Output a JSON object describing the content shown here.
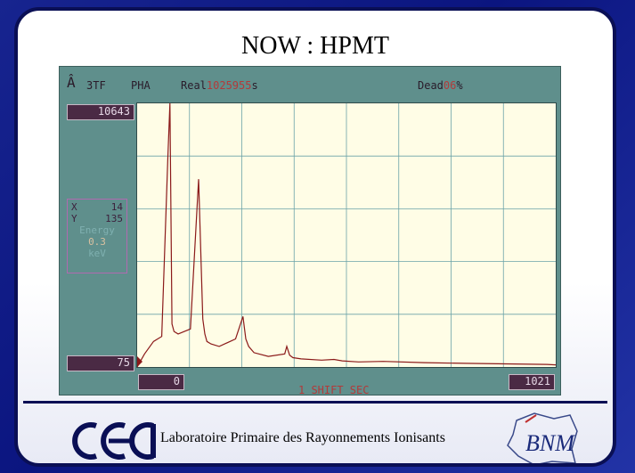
{
  "slide": {
    "title": "NOW : HPMT",
    "footer": "Laboratoire Primaire des Rayonnements Ionisants"
  },
  "analyzer": {
    "header": {
      "mode_icon": "Â",
      "input": "3TF",
      "mode": "PHA",
      "real_label": "Real",
      "real_value": "1025955",
      "real_unit": "s",
      "dead_label": "Dead",
      "dead_value": "06",
      "dead_unit": "%"
    },
    "ymax_label": "10643",
    "ymin_label": "75",
    "xmin_label": "0",
    "xmax_label": "1021",
    "cursor": {
      "x_label": "X",
      "x_value": "14",
      "y_label": "Y",
      "y_value": "135",
      "energy_label": "Energy",
      "energy_value": "0.3",
      "energy_unit": "keV"
    },
    "bottom_text": "1   SHIFT  SEC",
    "colors": {
      "trace": "#8b1a1a",
      "grid": "#6aa3a8",
      "plot_bg": "#fffde6",
      "panel": "#5f8f8c"
    }
  },
  "logos": {
    "left": "cea",
    "right": "BNM"
  },
  "chart_data": {
    "type": "line",
    "xlim": [
      0,
      1021
    ],
    "ylim": [
      75,
      10643
    ],
    "x": [
      0,
      18,
      40,
      60,
      75,
      80,
      85,
      90,
      100,
      130,
      150,
      160,
      165,
      170,
      180,
      200,
      240,
      258,
      265,
      272,
      285,
      320,
      360,
      365,
      372,
      380,
      400,
      450,
      480,
      500,
      540,
      600,
      700,
      800,
      900,
      1000,
      1021
    ],
    "y": [
      75,
      600,
      1100,
      1300,
      8500,
      10643,
      1800,
      1500,
      1400,
      1600,
      7600,
      2000,
      1400,
      1100,
      1000,
      900,
      1200,
      2100,
      1200,
      900,
      650,
      500,
      600,
      900,
      550,
      450,
      400,
      350,
      380,
      320,
      280,
      300,
      250,
      220,
      200,
      180,
      160
    ]
  }
}
